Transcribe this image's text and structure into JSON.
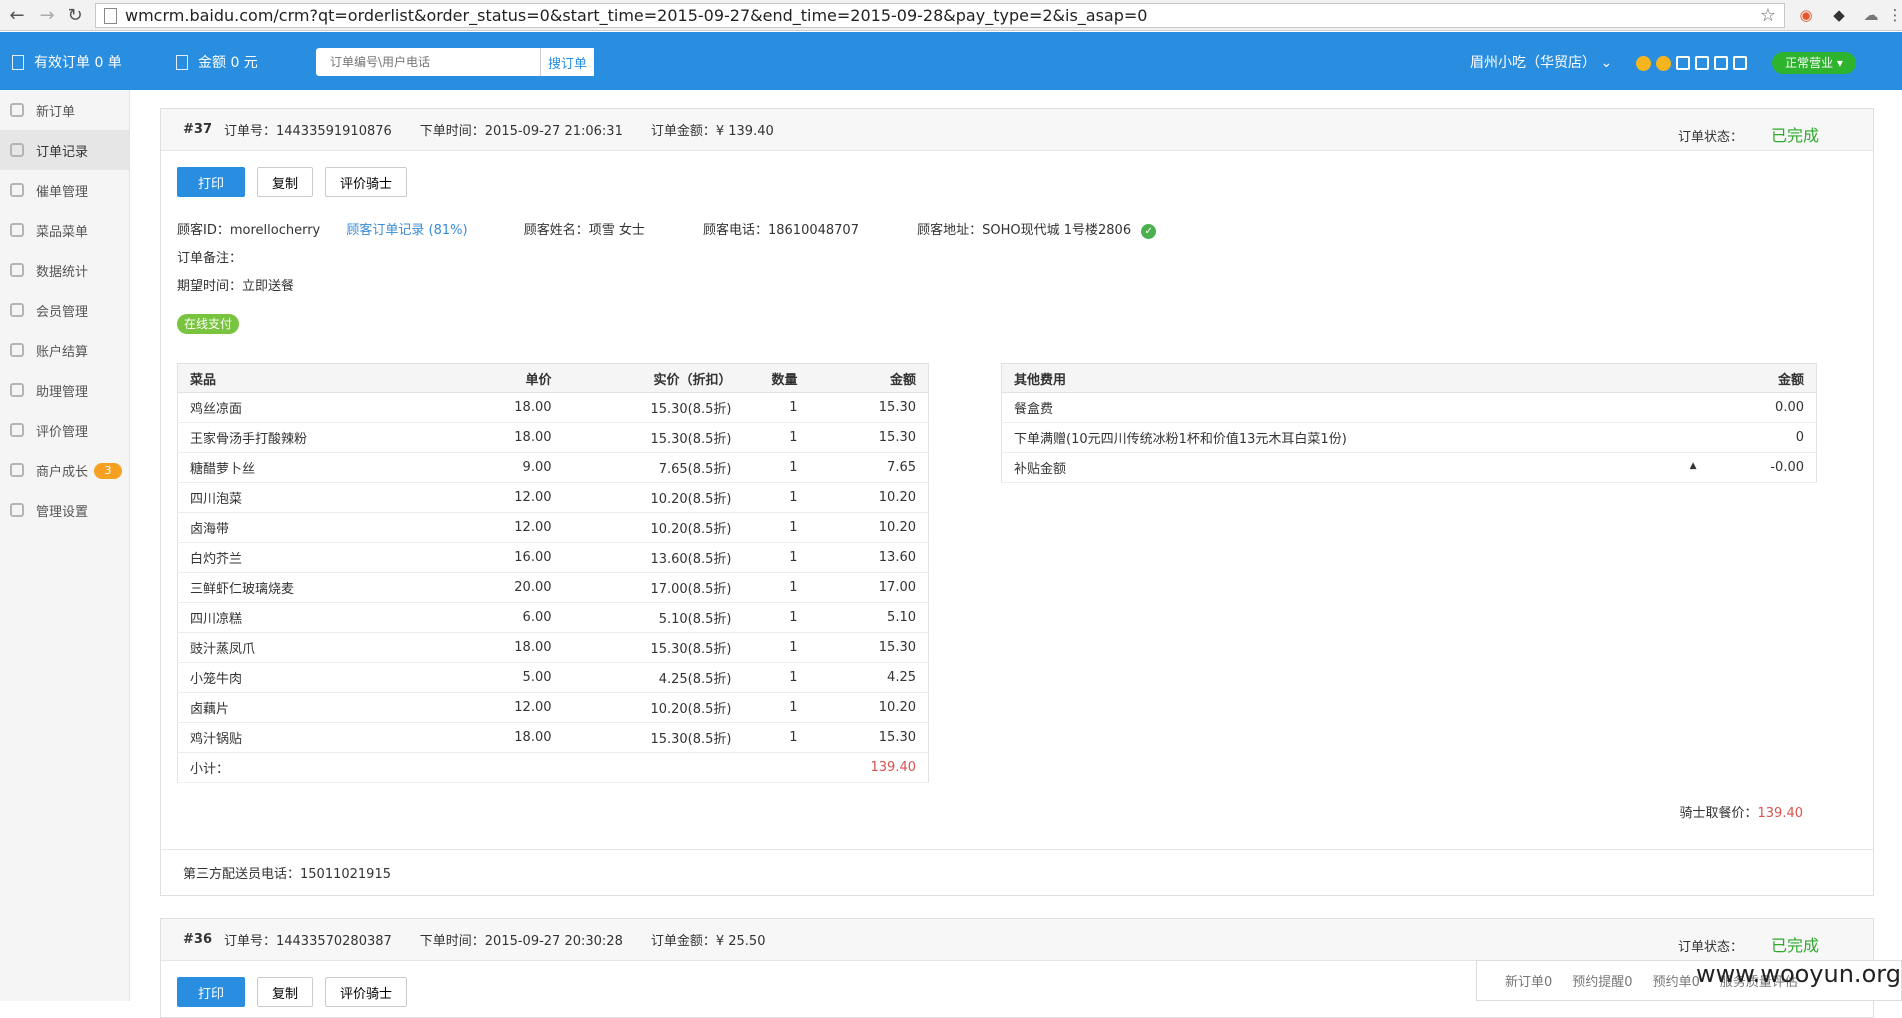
{
  "browser": {
    "url": "wmcrm.baidu.com/crm?qt=orderlist&order_status=0&start_time=2015-09-27&end_time=2015-09-28&pay_type=2&is_asap=0"
  },
  "topbar": {
    "valid_orders": "有效订单 0 单",
    "amount": "金额 0 元",
    "search_placeholder": "订单编号\\用户电话",
    "search_button": "搜订单",
    "shop_name": "眉州小吃（华贸店）",
    "business_status": "正常营业"
  },
  "sidebar": {
    "items": [
      {
        "label": "新订单",
        "icon": "new-order-icon"
      },
      {
        "label": "订单记录",
        "icon": "order-history-icon"
      },
      {
        "label": "催单管理",
        "icon": "reminder-icon"
      },
      {
        "label": "菜品菜单",
        "icon": "menu-icon"
      },
      {
        "label": "数据统计",
        "icon": "stats-icon"
      },
      {
        "label": "会员管理",
        "icon": "member-icon"
      },
      {
        "label": "账户结算",
        "icon": "settlement-icon"
      },
      {
        "label": "助理管理",
        "icon": "assistant-icon"
      },
      {
        "label": "评价管理",
        "icon": "review-icon"
      },
      {
        "label": "商户成长",
        "icon": "growth-icon",
        "badge": "3"
      },
      {
        "label": "管理设置",
        "icon": "settings-icon"
      }
    ]
  },
  "order1": {
    "number": "#37",
    "order_no": "订单号：14433591910876",
    "time": "下单时间：2015-09-27 21:06:31",
    "amount": "订单金额：¥ 139.40",
    "status_label": "订单状态：",
    "status_value": "已完成",
    "buttons": {
      "print": "打印",
      "copy": "复制",
      "rate": "评价骑士"
    },
    "customer_id": "顾客ID：morellocherry",
    "customer_history": "顾客订单记录 (81%)",
    "customer_name": "顾客姓名：项雪 女士",
    "customer_phone": "顾客电话：18610048707",
    "customer_address": "顾客地址：SOHO现代城 1号楼2806",
    "remark": "订单备注：",
    "expected": "期望时间：立即送餐",
    "pay_tag": "在线支付",
    "items_header": {
      "dish": "菜品",
      "price": "单价",
      "actual": "实价（折扣）",
      "qty": "数量",
      "amount": "金额"
    },
    "items": [
      {
        "dish": "鸡丝凉面",
        "price": "18.00",
        "actual": "15.30(8.5折)",
        "qty": "1",
        "amount": "15.30"
      },
      {
        "dish": "王家骨汤手打酸辣粉",
        "price": "18.00",
        "actual": "15.30(8.5折)",
        "qty": "1",
        "amount": "15.30"
      },
      {
        "dish": "糖醋萝卜丝",
        "price": "9.00",
        "actual": "7.65(8.5折)",
        "qty": "1",
        "amount": "7.65"
      },
      {
        "dish": "四川泡菜",
        "price": "12.00",
        "actual": "10.20(8.5折)",
        "qty": "1",
        "amount": "10.20"
      },
      {
        "dish": "卤海带",
        "price": "12.00",
        "actual": "10.20(8.5折)",
        "qty": "1",
        "amount": "10.20"
      },
      {
        "dish": "白灼芥兰",
        "price": "16.00",
        "actual": "13.60(8.5折)",
        "qty": "1",
        "amount": "13.60"
      },
      {
        "dish": "三鲜虾仁玻璃烧麦",
        "price": "20.00",
        "actual": "17.00(8.5折)",
        "qty": "1",
        "amount": "17.00"
      },
      {
        "dish": "四川凉糕",
        "price": "6.00",
        "actual": "5.10(8.5折)",
        "qty": "1",
        "amount": "5.10"
      },
      {
        "dish": "豉汁蒸凤爪",
        "price": "18.00",
        "actual": "15.30(8.5折)",
        "qty": "1",
        "amount": "15.30"
      },
      {
        "dish": "小笼牛肉",
        "price": "5.00",
        "actual": "4.25(8.5折)",
        "qty": "1",
        "amount": "4.25"
      },
      {
        "dish": "卤藕片",
        "price": "12.00",
        "actual": "10.20(8.5折)",
        "qty": "1",
        "amount": "10.20"
      },
      {
        "dish": "鸡汁锅贴",
        "price": "18.00",
        "actual": "15.30(8.5折)",
        "qty": "1",
        "amount": "15.30"
      }
    ],
    "subtotal_label": "小计：",
    "subtotal_value": "139.40",
    "fees_header": {
      "name": "其他费用",
      "amount": "金额"
    },
    "fees": [
      {
        "name": "餐盒费",
        "amount": "0.00"
      },
      {
        "name": "下单满赠(10元四川传统冰粉1杯和价值13元木耳白菜1份)",
        "amount": "0"
      },
      {
        "name": "补贴金额",
        "amount": "-0.00"
      }
    ],
    "rider_label": "骑士取餐价：",
    "rider_value": "139.40",
    "courier_phone": "第三方配送员电话：15011021915"
  },
  "order2": {
    "number": "#36",
    "order_no": "订单号：14433570280387",
    "time": "下单时间：2015-09-27 20:30:28",
    "amount": "订单金额：¥ 25.50",
    "status_label": "订单状态：",
    "status_value": "已完成",
    "buttons": {
      "print": "打印",
      "copy": "复制",
      "rate": "评价骑士"
    }
  },
  "notify_bar": {
    "new": "新订单0",
    "reserve_remind": "预约提醒0",
    "reserve": "预约单0",
    "service": "服务质量评估"
  },
  "watermark": "www.wooyun.org",
  "colors": {
    "primary": "#2a8ee0",
    "success": "#2eaa2e",
    "danger": "#d9534f",
    "badge": "#f6a022"
  }
}
